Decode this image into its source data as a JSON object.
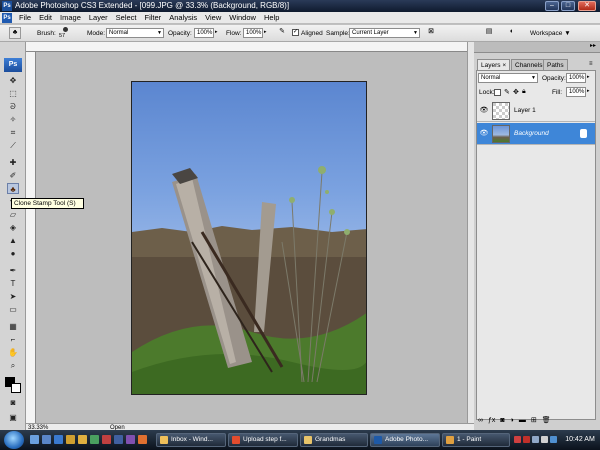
{
  "window": {
    "title": "Adobe Photoshop CS3 Extended - [099.JPG @ 33.3% (Background, RGB/8)]",
    "app_icon": "Ps"
  },
  "menu": [
    "File",
    "Edit",
    "Image",
    "Layer",
    "Select",
    "Filter",
    "Analysis",
    "View",
    "Window",
    "Help"
  ],
  "options_bar": {
    "brush_label": "Brush:",
    "brush_size": "57",
    "mode_label": "Mode:",
    "mode_value": "Normal",
    "opacity_label": "Opacity:",
    "opacity_value": "100%",
    "flow_label": "Flow:",
    "flow_value": "100%",
    "aligned_label": "Aligned",
    "sample_label": "Sample:",
    "sample_value": "Current Layer",
    "workspace_label": "Workspace"
  },
  "toolbox": {
    "logo": "Ps",
    "active_tool_tooltip": "Clone Stamp Tool (S)"
  },
  "status_bar": {
    "zoom": "33.33%",
    "doc_info": "Open"
  },
  "layers_panel": {
    "tabs": [
      "Layers",
      "Channels",
      "Paths"
    ],
    "blend_mode": "Normal",
    "opacity_label": "Opacity:",
    "opacity_value": "100%",
    "lock_label": "Lock:",
    "fill_label": "Fill:",
    "fill_value": "100%",
    "layers": [
      {
        "name": "Layer 1"
      },
      {
        "name": "Background"
      }
    ]
  },
  "taskbar": {
    "items": [
      {
        "label": "Inbox - Wind...",
        "icon_color": "#f0c05a"
      },
      {
        "label": "Upload step f...",
        "icon_color": "#e24c2e"
      },
      {
        "label": "Grandmas",
        "icon_color": "#e8c46a"
      },
      {
        "label": "Adobe Photo...",
        "icon_color": "#1e5aa8"
      },
      {
        "label": "1 - Paint",
        "icon_color": "#e0a040"
      }
    ],
    "clock": "10:42 AM"
  },
  "colors": {
    "accent": "#3e86d8",
    "titlebar": "#1a2740",
    "taskbar": "#1a2433"
  }
}
